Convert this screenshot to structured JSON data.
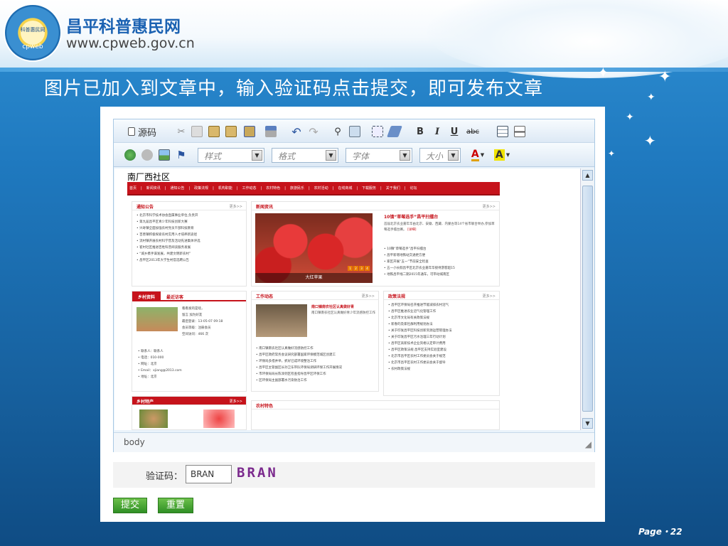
{
  "slide": {
    "site_name": "昌平科普惠民网",
    "site_url": "www.cpweb.gov.cn",
    "logo_text": "科普惠民网",
    "logo_small": "cpweb",
    "headline": "图片已加入到文章中，输入验证码点击提交，即可发布文章",
    "page_number": "Page・22"
  },
  "toolbar": {
    "source_label": "源码",
    "bold": "B",
    "italic": "I",
    "underline": "U",
    "strike": "abc",
    "style_placeholder": "样式",
    "format_placeholder": "格式",
    "font_placeholder": "字体",
    "size_placeholder": "大小",
    "text_color": "A",
    "bg_color": "A"
  },
  "content": {
    "page_title": "南厂西社区",
    "nav_items": [
      "首页",
      "新闻资讯",
      "通知公告",
      "政策法规",
      "机构职能",
      "工作动态",
      "农村特色",
      "旅游民乐",
      "农村活动",
      "在线商城",
      "下载服务",
      "关于我们",
      "论坛"
    ],
    "notice_title": "通知公告",
    "more": "更多>>",
    "notice_items": [
      "北京市科学技术协会直属事业单位,负责开",
      "第九届昌平区青少年科技创新大赛",
      "兴寿镇全面加强农村党员干部科技教育",
      "百善镇积极探索农村实用人才培养新途径",
      "流村镇开展农村科学普及活动先进集体评选",
      "崔村社区推进百姓科普阅读服务发展",
      "“城乡携手谋发展，共建文明新农村”",
      "昌平区2013年大学生村官选聘公告"
    ],
    "news_title": "新闻资讯",
    "news_feature": "10镇“草莓选手”昌平扫擂台",
    "news_feature_desc": "首届北京农业嘉年华由北京、安徽、西藏、内蒙古等14个省市联合举办,参加草莓选手擂台赛。",
    "news_detail": "[详细]",
    "photo_caption": "大红苹果",
    "news_items": [
      "10镇“草莓选手”昌平扫擂台",
      "昌平新增地铁站交通更方便",
      "家区开展“五一”节前安全检查",
      "五一小长假昌平区北京农业嘉年华接待游客超15",
      "地铁昌平线二期2015年通车，可带动城南区"
    ],
    "village_tab1": "乡村资料",
    "village_tab2": "最近访客",
    "village_profile": [
      "看看发的是啥，",
      "留言  加为好友",
      "最后登录：13-05-07 09:18",
      "会员等级：注册会员",
      "空间访问：466 次"
    ],
    "contacts": [
      "联系人：联系人",
      "电话：010-000",
      "网址：北京",
      "Email：xjiang@2013.com",
      "地址：北京"
    ],
    "work_title": "工作动态",
    "work_feature": "南口镇南农社区认真做好青",
    "work_feature_desc": "南口镇南农社区认真做好青少年流感防控工作",
    "work_items": [
      "南口镇南农社区认真做好流感防控工作",
      "昌平区政府常务会议研究部署国家环保模范城区创建工",
      "环保局多措并举，抓好已成环境整治工作",
      "昌平区主管副区长孙卫东带队环保局调研环保工作开展情况",
      "市环保局局长陈添到区检查指导昌平区环保工作",
      "区环保局主副部署水污染防治工作"
    ],
    "policy_title": "政策法规",
    "policy_items": [
      "昌平区环保局召开推进节能减排农村沼气",
      "昌平区推进农业沼气化管理工作",
      "北京市文化局有关政策法规",
      "新春的及家社群利用规划办法",
      "关于印发昌平区科技创新资源运营管理办法",
      "关于印发昌平区污水治理三年行动计划",
      "昌平区高新技术企业资格认定审计费用",
      "昌平区政策法规 昌平区支持实验室建设",
      "北京市昌平区农村工作委员会关于规范",
      "北京市昌平区农村工作委员会关于督导",
      "农村政策法规"
    ],
    "rural_title": "乡村特产",
    "farm_title": "农村特色",
    "path_label": "body"
  },
  "captcha": {
    "label": "验证码：",
    "value": "BRAN",
    "image_text": "BRAN"
  },
  "actions": {
    "submit": "提交",
    "reset": "重置"
  },
  "colors": {
    "slide_blue": "#1f79bf",
    "nav_red": "#c6131b",
    "button_green": "#3a9a2c"
  }
}
